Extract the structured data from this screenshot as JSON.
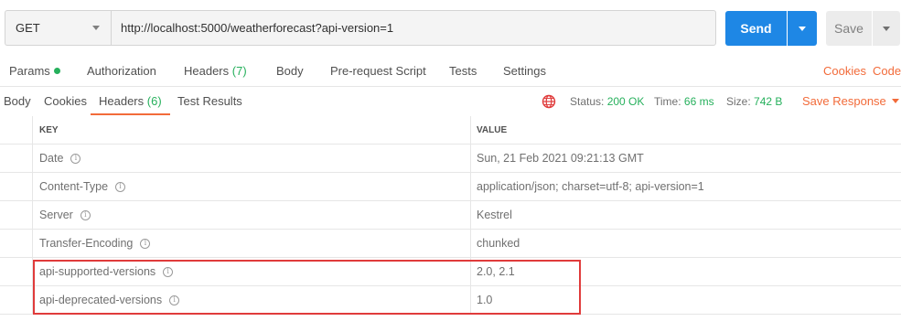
{
  "request": {
    "method": "GET",
    "url": "http://localhost:5000/weatherforecast?api-version=1",
    "send_label": "Send",
    "save_label": "Save"
  },
  "request_tabs": {
    "params": "Params",
    "authorization": "Authorization",
    "headers": "Headers",
    "headers_count": "(7)",
    "body": "Body",
    "pre_request": "Pre-request Script",
    "tests": "Tests",
    "settings": "Settings",
    "cookies": "Cookies",
    "code": "Code"
  },
  "response_tabs": {
    "body": "Body",
    "cookies": "Cookies",
    "headers": "Headers",
    "headers_count": "(6)",
    "test_results": "Test Results"
  },
  "response_meta": {
    "status_label": "Status:",
    "status_value": "200 OK",
    "time_label": "Time:",
    "time_value": "66 ms",
    "size_label": "Size:",
    "size_value": "742 B",
    "save_response": "Save Response"
  },
  "headers_table": {
    "columns": {
      "key": "KEY",
      "value": "VALUE"
    },
    "rows": [
      {
        "key": "Date",
        "value": "Sun, 21 Feb 2021 09:21:13 GMT"
      },
      {
        "key": "Content-Type",
        "value": "application/json; charset=utf-8; api-version=1"
      },
      {
        "key": "Server",
        "value": "Kestrel"
      },
      {
        "key": "Transfer-Encoding",
        "value": "chunked"
      },
      {
        "key": "api-supported-versions",
        "value": "2.0, 2.1"
      },
      {
        "key": "api-deprecated-versions",
        "value": "1.0"
      }
    ],
    "info_glyph": "i"
  },
  "colors": {
    "accent": "#f26b3a",
    "primary": "#1e87e5",
    "success": "#26b05c",
    "highlight": "#e03b3b"
  },
  "icons": {
    "globe": "globe-icon",
    "info": "info-icon",
    "dropdown": "chevron-down-icon"
  }
}
